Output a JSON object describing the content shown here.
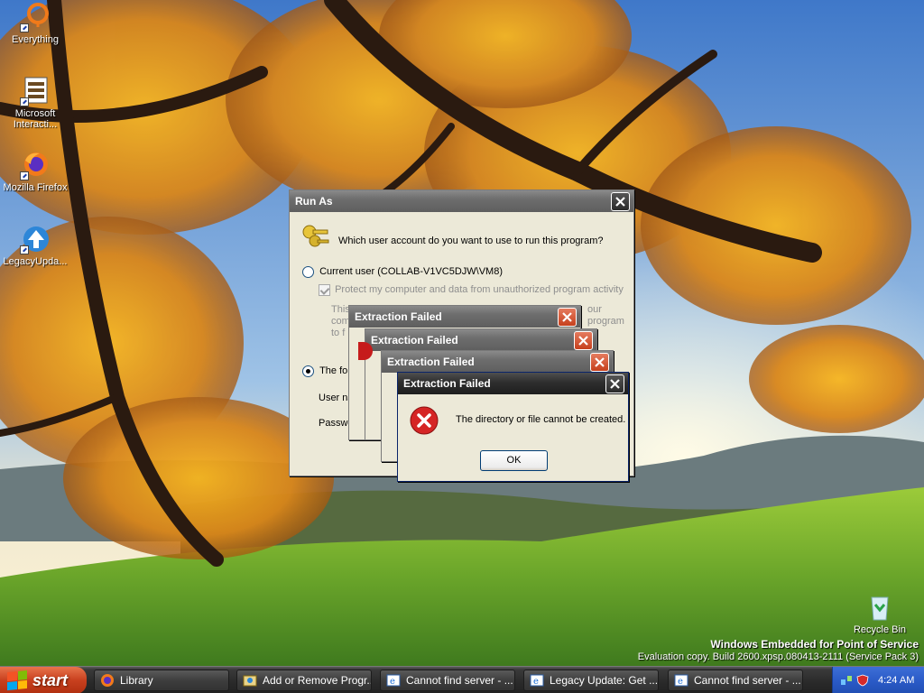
{
  "desktop": {
    "icons": [
      {
        "label": "Everything",
        "icon": "everything-icon"
      },
      {
        "label": "Microsoft Interacti...",
        "icon": "mta-icon"
      },
      {
        "label": "Mozilla Firefox",
        "icon": "firefox-icon"
      },
      {
        "label": "LegacyUpda...",
        "icon": "legacy-update-icon"
      },
      {
        "label": "Recycle Bin",
        "icon": "recycle-bin-icon"
      }
    ],
    "watermark": {
      "line1": "Windows Embedded for Point of Service",
      "line2": "Evaluation copy. Build 2600.xpsp.080413-2111 (Service Pack 3)"
    }
  },
  "run_as": {
    "title": "Run As",
    "question": "Which user account do you want to use to run this program?",
    "current_user": "Current user (COLLAB-V1VC5DJW\\VM8)",
    "protect_option": "Protect my computer and data from unauthorized program activity",
    "protect_desc_left": [
      "This",
      "com",
      "to f"
    ],
    "protect_desc_right": [
      "our",
      "program"
    ],
    "following_user": "The foll",
    "user_name_label": "User na",
    "password_label": "Password:"
  },
  "error_dialogs": [
    {
      "title": "Extraction Failed"
    },
    {
      "title": "Extraction Failed"
    },
    {
      "title": "Extraction Failed"
    },
    {
      "title": "Extraction Failed",
      "message": "The directory or file cannot be created.",
      "ok_label": "OK"
    }
  ],
  "taskbar": {
    "start_label": "start",
    "buttons": [
      {
        "label": "Library",
        "icon": "firefox-icon"
      },
      {
        "label": "Add or Remove Progr...",
        "icon": "add-remove-icon"
      },
      {
        "label": "Cannot find server - ...",
        "icon": "ie-icon"
      },
      {
        "label": "Legacy Update: Get ...",
        "icon": "ie-icon"
      },
      {
        "label": "Cannot find server - ...",
        "icon": "ie-icon"
      }
    ],
    "clock": "4:24 AM"
  }
}
